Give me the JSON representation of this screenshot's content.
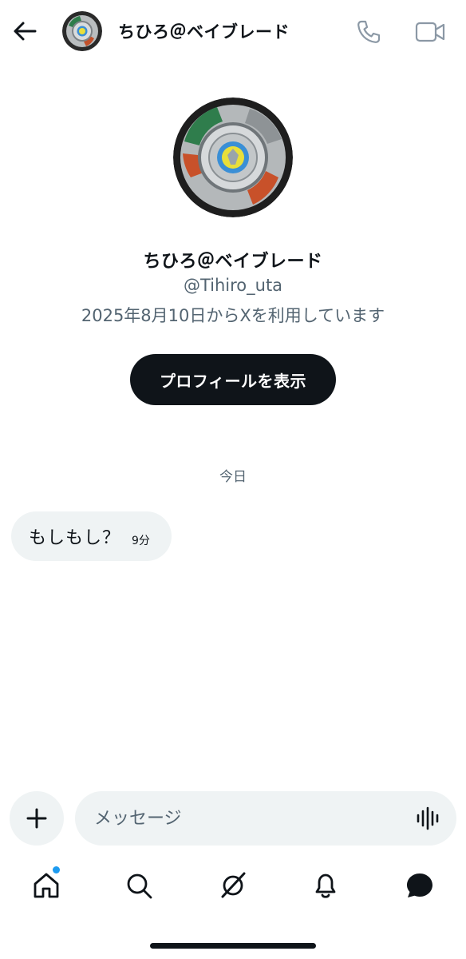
{
  "header": {
    "name": "ちひろ＠ベイブレード",
    "icons": [
      "back-arrow-icon",
      "phone-icon",
      "video-icon"
    ]
  },
  "profile": {
    "name": "ちひろ＠ベイブレード",
    "handle": "@Tihiro_uta",
    "joined": "2025年8月10日からXを利用しています",
    "view_profile_label": "プロフィールを表示"
  },
  "conversation": {
    "day_label": "今日",
    "messages": [
      {
        "text": "もしもし？",
        "time": "9分"
      }
    ]
  },
  "composer": {
    "placeholder": "メッセージ",
    "icons": [
      "plus-icon",
      "voice-icon"
    ]
  },
  "nav": {
    "items": [
      "home-icon",
      "search-icon",
      "grok-icon",
      "notifications-icon",
      "messages-icon"
    ],
    "home_has_notification": true
  },
  "colors": {
    "text": "#0f1419",
    "secondary": "#536471",
    "bubble": "#eff3f4",
    "accent": "#1d9bf0"
  }
}
